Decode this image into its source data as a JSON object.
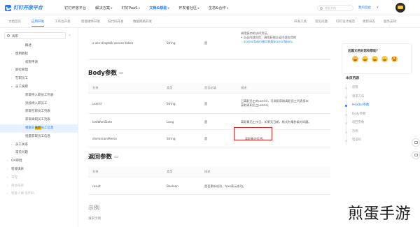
{
  "header": {
    "logo_text": "钉钉开放平台",
    "nav": [
      {
        "label": "钉钉开放平台",
        "active": false,
        "dropdown": false
      },
      {
        "label": "解决方案",
        "active": false,
        "dropdown": true
      },
      {
        "label": "钉钉PaaS",
        "active": false,
        "dropdown": true
      },
      {
        "label": "文档&帮助",
        "active": true,
        "dropdown": true
      },
      {
        "label": "开发者社区",
        "active": false,
        "dropdown": true
      },
      {
        "label": "生态&合作",
        "active": false,
        "dropdown": true
      }
    ],
    "search_placeholder": "搜索文档",
    "workbench_label": "我的后台",
    "accent_color": "#1f7aff"
  },
  "subtabs": [
    {
      "label": "文档首页",
      "active": false
    },
    {
      "label": "应用开发",
      "active": true
    },
    {
      "label": "工作台开发",
      "active": false
    },
    {
      "label": "智能硬件开发",
      "active": false
    },
    {
      "label": "低代码开发",
      "active": false
    },
    {
      "label": "数据网格开发",
      "active": false
    },
    {
      "label": "开发工具",
      "active": false
    },
    {
      "label": "常见问题",
      "active": false
    },
    {
      "label": "钉钉设计规范",
      "active": false
    },
    {
      "label": "更新日志",
      "active": false
    },
    {
      "label": "服务支持",
      "active": false
    }
  ],
  "sidebar": {
    "search_value": "离职",
    "items": [
      {
        "label": "概述",
        "level": 2,
        "arrow": false,
        "state": "normal"
      },
      {
        "label": "使用教程",
        "level": 1,
        "arrow": true,
        "state": "normal"
      },
      {
        "label": "权限申请",
        "level": 2,
        "arrow": false,
        "state": "normal"
      },
      {
        "label": "职位管理",
        "level": 1,
        "arrow": true,
        "state": "normal"
      },
      {
        "label": "在职员工",
        "level": 1,
        "arrow": true,
        "state": "normal"
      },
      {
        "label": "员工离职",
        "level": 1,
        "arrow": true,
        "expanded": true,
        "state": "normal"
      },
      {
        "label": "获取待入职员工列表",
        "level": 2,
        "arrow": false,
        "state": "normal"
      },
      {
        "label": "添加待入职员工",
        "level": 2,
        "arrow": false,
        "state": "normal"
      },
      {
        "label": "获取在职员工列表",
        "level": 2,
        "arrow": false,
        "state": "normal"
      },
      {
        "label_pre": "获取",
        "label_hl": "离职",
        "label_post": "员工列表",
        "level": 2,
        "arrow": false,
        "state": "normal"
      },
      {
        "label_pre": "根据日",
        "label_hl": "离职",
        "label_post": "员工信息",
        "level": 2,
        "arrow": false,
        "state": "active"
      },
      {
        "label": "批量获取员工信息",
        "level": 2,
        "arrow": false,
        "state": "normal"
      },
      {
        "label": "员工关系",
        "level": 1,
        "arrow": true,
        "state": "normal"
      },
      {
        "label": "常见问题",
        "level": 1,
        "arrow": false,
        "state": "normal"
      },
      {
        "label": "OA审批",
        "level": 0,
        "arrow": true,
        "state": "normal"
      },
      {
        "label": "智能填表",
        "level": 0,
        "arrow": true,
        "state": "normal"
      },
      {
        "label": "日程",
        "level": 0,
        "arrow": true,
        "state": "faded"
      },
      {
        "label": "待办任务",
        "level": 0,
        "arrow": true,
        "state": "faded"
      },
      {
        "label": "智能人事 低代码",
        "level": 0,
        "arrow": true,
        "state": "faded"
      }
    ]
  },
  "header_row": {
    "name": "x-acs-dingtalk-access-token",
    "type": "String",
    "required": "是",
    "desc_lines": [
      {
        "text": "调用接口的访问凭证。",
        "link": false
      },
      {
        "text": "企业内部应用，调用获取企业内部应用的",
        "link_text": "获取企业内部应用的",
        "link": true
      },
      {
        "text": "accessToken接口获取accessToken。",
        "link": true
      }
    ]
  },
  "body_params": {
    "title": "Body参数",
    "columns": [
      "名称",
      "类型",
      "是否必填",
      "描述"
    ],
    "rows": [
      {
        "name": "userid",
        "type": "String",
        "required": "是",
        "desc_lines": [
          "已离职员工的userid，可调用获取离职员工列表接口",
          "获取离职员工userId。"
        ]
      },
      {
        "name": "lastWorkDate",
        "type": "Long",
        "required": "是",
        "desc_lines": [
          "离职最后工作日，如果无日期，格式为毫秒级时间戳。"
        ]
      },
      {
        "name": "dismissionMemo",
        "type": "String",
        "required": "是",
        "desc_lines": [
          "离职备注信息。"
        ]
      }
    ]
  },
  "return_params": {
    "title": "返回参数",
    "columns": [
      "名称",
      "类型",
      "描述"
    ],
    "rows": [
      {
        "name": "result",
        "type": "Boolean",
        "desc": "是否更新成功，true表示成功。"
      }
    ]
  },
  "example": {
    "title": "示例",
    "request_label": "请求示例"
  },
  "right_panel": {
    "feedback_question": "这篇文档对您有帮助？",
    "emojis": [
      "sad",
      "meh",
      "neutral",
      "smile",
      "love"
    ],
    "toc_title": "本页内容",
    "toc": [
      {
        "label": "权限",
        "active": false
      },
      {
        "label": "请求方法",
        "active": false
      },
      {
        "label": "Header参数",
        "active": true
      },
      {
        "label": "Body参数",
        "active": false
      },
      {
        "label": "返回参数",
        "active": false
      },
      {
        "label": "示例",
        "active": false
      },
      {
        "label": "错误码",
        "active": false
      }
    ]
  },
  "watermark": "煎蛋手游"
}
